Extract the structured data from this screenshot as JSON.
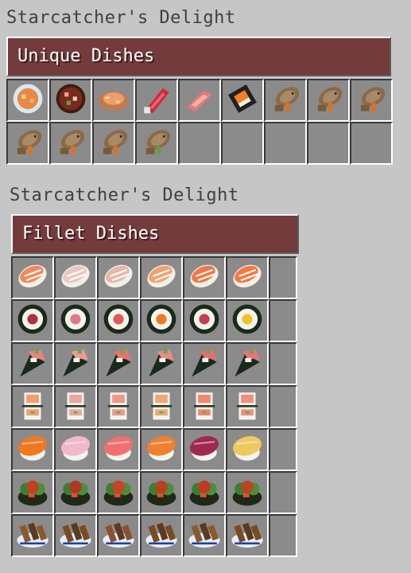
{
  "sections": [
    {
      "window_title": "Starcatcher's Delight",
      "banner": "Unique Dishes",
      "slots": [
        {
          "icon": "soup-bowl-icon"
        },
        {
          "icon": "stew-bowl-icon"
        },
        {
          "icon": "fried-fish-icon"
        },
        {
          "icon": "red-fish-fillet-icon"
        },
        {
          "icon": "pink-fish-fillet-icon"
        },
        {
          "icon": "nigiri-roll-icon"
        },
        {
          "icon": "dried-fish-icon"
        },
        {
          "icon": "dried-fish-icon"
        },
        {
          "icon": "dried-fish-icon"
        },
        {
          "icon": "dried-fish-icon"
        },
        {
          "icon": "dried-fish-icon"
        },
        {
          "icon": "dried-fish-icon"
        },
        {
          "icon": "dried-fish-green-icon"
        },
        {
          "icon": "empty"
        },
        {
          "icon": "empty"
        },
        {
          "icon": "empty"
        },
        {
          "icon": "empty"
        },
        {
          "icon": "empty"
        }
      ]
    },
    {
      "window_title": "Starcatcher's Delight",
      "banner": "Fillet Dishes",
      "rows": [
        {
          "kind": "sashimi-icon",
          "colors": [
            "#f08a5d",
            "#e8c8c0",
            "#e6b8a8",
            "#f4a070",
            "#f07848",
            "#f87840"
          ]
        },
        {
          "kind": "maki-roll-icon",
          "colors": [
            "#b03040",
            "#e07888",
            "#e05858",
            "#f07820",
            "#c04050",
            "#f0c030"
          ]
        },
        {
          "kind": "temaki-icon",
          "colors": [
            "#f08080",
            "#f098a0",
            "#f07070",
            "#f08888",
            "#f06878",
            "#f07080"
          ]
        },
        {
          "kind": "sushi-roll-icon",
          "colors": [
            "#f0a070",
            "#e8a8a0",
            "#f09888",
            "#f0a878",
            "#f08870",
            "#f09080"
          ]
        },
        {
          "kind": "nigiri-icon",
          "colors": [
            "#f07820",
            "#f0b8c8",
            "#f07070",
            "#f08030",
            "#a02850",
            "#f0c860"
          ]
        },
        {
          "kind": "salad-bowl-icon",
          "colors": [
            "#c04020",
            "#b03828",
            "#c84428",
            "#b84020",
            "#c03820",
            "#b84424"
          ]
        },
        {
          "kind": "skewer-plate-icon",
          "colors": [
            "#8b5a2b",
            "#7a4a22",
            "#8b5030",
            "#7a4a22",
            "#8b5a2b",
            "#7a4a22"
          ]
        }
      ],
      "accent": "#733b3b"
    }
  ]
}
